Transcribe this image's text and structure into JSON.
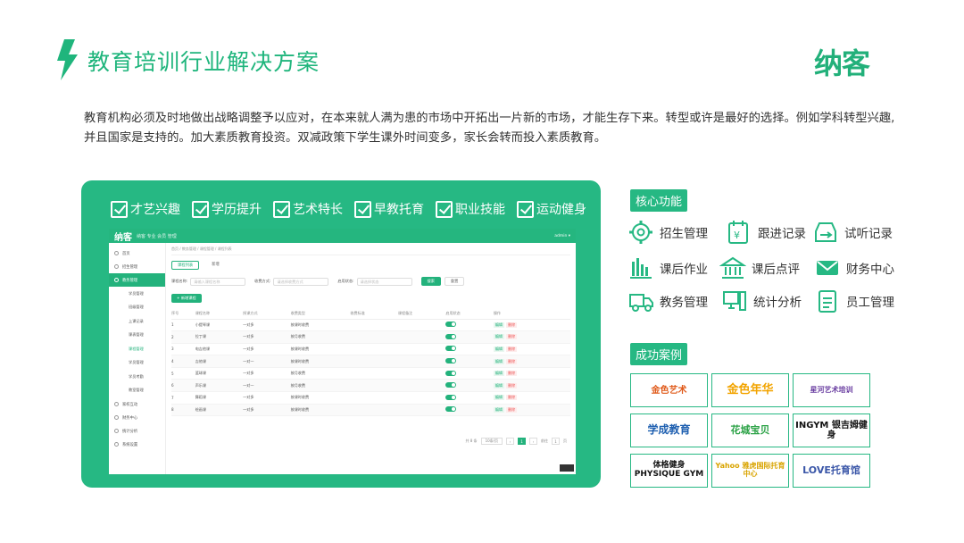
{
  "header": {
    "title": "教育培训行业解决方案",
    "brand": "纳客"
  },
  "intro": "教育机构必须及时地做出战略调整予以应对，在本来就人满为患的市场中开拓出一片新的市场，才能生存下来。转型或许是最好的选择。例如学科转型兴趣,并且国家是支持的。加大素质教育投资。双减政策下学生课外时间变多，家长会转而投入素质教育。",
  "tags": [
    "才艺兴趣",
    "学历提升",
    "艺术特长",
    "早教托育",
    "职业技能",
    "运动健身"
  ],
  "app": {
    "logo": "纳客",
    "slogan": "纳客 专业 会员 管理",
    "user": "admin ▾",
    "breadcrumb": "首页 / 教务管理 / 课程管理 / 课程列表",
    "sidebar": [
      {
        "label": "首页",
        "active": false
      },
      {
        "label": "招生管理",
        "active": false
      },
      {
        "label": "教务管理",
        "active": true
      }
    ],
    "sidebar_sub": [
      "学员管理",
      "班级管理",
      "上课记录",
      "课表管理",
      "课程管理",
      "学员管理",
      "学员考勤",
      "教室管理"
    ],
    "sidebar_bottom": [
      "家校互动",
      "财务中心",
      "统计分析",
      "系统设置"
    ],
    "subtabs": [
      "课程列表",
      "新增"
    ],
    "filters": [
      {
        "label": "课程名称:",
        "placeholder": "请输入课程名称"
      },
      {
        "label": "收费方式:",
        "placeholder": "请选择收费方式"
      },
      {
        "label": "启用状态:",
        "placeholder": "请选择状态"
      }
    ],
    "search_btn": "搜索",
    "reset_btn": "重置",
    "add_btn": "+ 新增课程",
    "columns": [
      "序号",
      "课程名称",
      "授课方式",
      "收费类型",
      "收费标准",
      "课程备注",
      "启用状态",
      "操作"
    ],
    "rows": [
      {
        "no": "1",
        "name": "小提琴课",
        "mode": "一对多",
        "fee": "按课时收费"
      },
      {
        "no": "2",
        "name": "拉丁课",
        "mode": "一对多",
        "fee": "按月收费"
      },
      {
        "no": "3",
        "name": "电吉他课",
        "mode": "一对多",
        "fee": "按课时收费"
      },
      {
        "no": "4",
        "name": "吉他课",
        "mode": "一对一",
        "fee": "按课时收费"
      },
      {
        "no": "5",
        "name": "篮球课",
        "mode": "一对多",
        "fee": "按月收费"
      },
      {
        "no": "6",
        "name": "声乐课",
        "mode": "一对一",
        "fee": "按月收费"
      },
      {
        "no": "7",
        "name": "舞蹈课",
        "mode": "一对多",
        "fee": "按课时收费"
      },
      {
        "no": "8",
        "name": "绘画课",
        "mode": "一对多",
        "fee": "按课时收费"
      }
    ],
    "edit_label": "编辑",
    "delete_label": "删除",
    "pager": {
      "total": "共 8 条",
      "size": "10条/页",
      "current": "1",
      "goto_label": "前往",
      "page_unit": "页",
      "goto_value": "1"
    }
  },
  "core": {
    "label": "核心功能",
    "items": [
      {
        "label": "招生管理",
        "icon": "gear-icon"
      },
      {
        "label": "跟进记录",
        "icon": "calendar-money-icon"
      },
      {
        "label": "试听记录",
        "icon": "inbox-icon"
      },
      {
        "label": "课后作业",
        "icon": "bar-chart-icon"
      },
      {
        "label": "课后点评",
        "icon": "building-icon"
      },
      {
        "label": "财务中心",
        "icon": "mail-icon"
      },
      {
        "label": "教务管理",
        "icon": "truck-icon"
      },
      {
        "label": "统计分析",
        "icon": "pc-icon"
      },
      {
        "label": "员工管理",
        "icon": "document-icon"
      }
    ]
  },
  "cases": {
    "label": "成功案例",
    "items": [
      {
        "name": "金色艺术",
        "color": "#e05a1a"
      },
      {
        "name": "金色年华",
        "color": "#f2a400"
      },
      {
        "name": "星河艺术培训",
        "color": "#6a3ea1"
      },
      {
        "name": "学成教育",
        "color": "#1e5fb0"
      },
      {
        "name": "花城宝贝",
        "color": "#2ba246"
      },
      {
        "name": "INGYM 银吉姆健身",
        "color": "#111111"
      },
      {
        "name": "体格健身 PHYSIQUE GYM",
        "color": "#111111"
      },
      {
        "name": "Yahoo 雅虎国际托育中心",
        "color": "#d9a400"
      },
      {
        "name": "LOVE托育馆",
        "color": "#3a56a8"
      }
    ]
  },
  "colors": {
    "accent": "#26b883",
    "title": "#1fb57c"
  }
}
